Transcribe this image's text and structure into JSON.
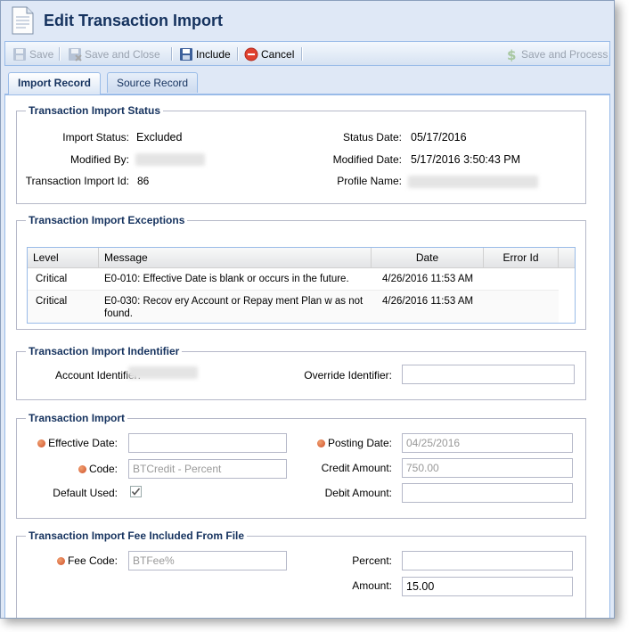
{
  "window": {
    "title": "Edit Transaction Import"
  },
  "toolbar": {
    "save": "Save",
    "save_and_close": "Save and Close",
    "include": "Include",
    "cancel": "Cancel",
    "save_and_process": "Save and Process"
  },
  "tabs": [
    {
      "label": "Import Record",
      "active": true
    },
    {
      "label": "Source Record",
      "active": false
    }
  ],
  "status_section": {
    "legend": "Transaction Import Status",
    "import_status_label": "Import Status:",
    "import_status_value": "Excluded",
    "modified_by_label": "Modified By:",
    "transaction_import_id_label": "Transaction Import Id:",
    "transaction_import_id_value": "86",
    "status_date_label": "Status Date:",
    "status_date_value": "05/17/2016",
    "modified_date_label": "Modified Date:",
    "modified_date_value": "5/17/2016 3:50:43 PM",
    "profile_name_label": "Profile Name:"
  },
  "exceptions_section": {
    "legend": "Transaction Import Exceptions",
    "columns": [
      "Level",
      "Message",
      "Date",
      "Error Id"
    ],
    "rows": [
      {
        "level": "Critical",
        "message_line1": "E0-010: Effective Date is blank or occurs in the future.",
        "message_line2": "",
        "date": "4/26/2016 11:53 AM",
        "error_id": ""
      },
      {
        "level": "Critical",
        "message_line1": "E0-030: Recov ery Account or Repay ment Plan w as not",
        "message_line2": "found.",
        "date": "4/26/2016 11:53 AM",
        "error_id": ""
      }
    ]
  },
  "identifier_section": {
    "legend": "Transaction Import Indentifier",
    "account_identifier_label": "Account Identifier:",
    "override_identifier_label": "Override Identifier:",
    "override_identifier_value": ""
  },
  "import_section": {
    "legend": "Transaction Import",
    "effective_date_label": "Effective Date:",
    "effective_date_value": "",
    "code_label": "Code:",
    "code_value": "BTCredit - Percent",
    "default_used_label": "Default Used:",
    "default_used_checked": true,
    "posting_date_label": "Posting Date:",
    "posting_date_value": "04/25/2016",
    "credit_amount_label": "Credit Amount:",
    "credit_amount_value": "750.00",
    "debit_amount_label": "Debit Amount:",
    "debit_amount_value": ""
  },
  "fee_section": {
    "legend": "Transaction Import Fee Included From File",
    "fee_code_label": "Fee Code:",
    "fee_code_value": "BTFee%",
    "percent_label": "Percent:",
    "percent_value": "",
    "amount_label": "Amount:",
    "amount_value": "15.00"
  },
  "colors": {
    "title": "#15325e",
    "accent_border": "#99bbe8",
    "required_dot": "#d0502a"
  }
}
